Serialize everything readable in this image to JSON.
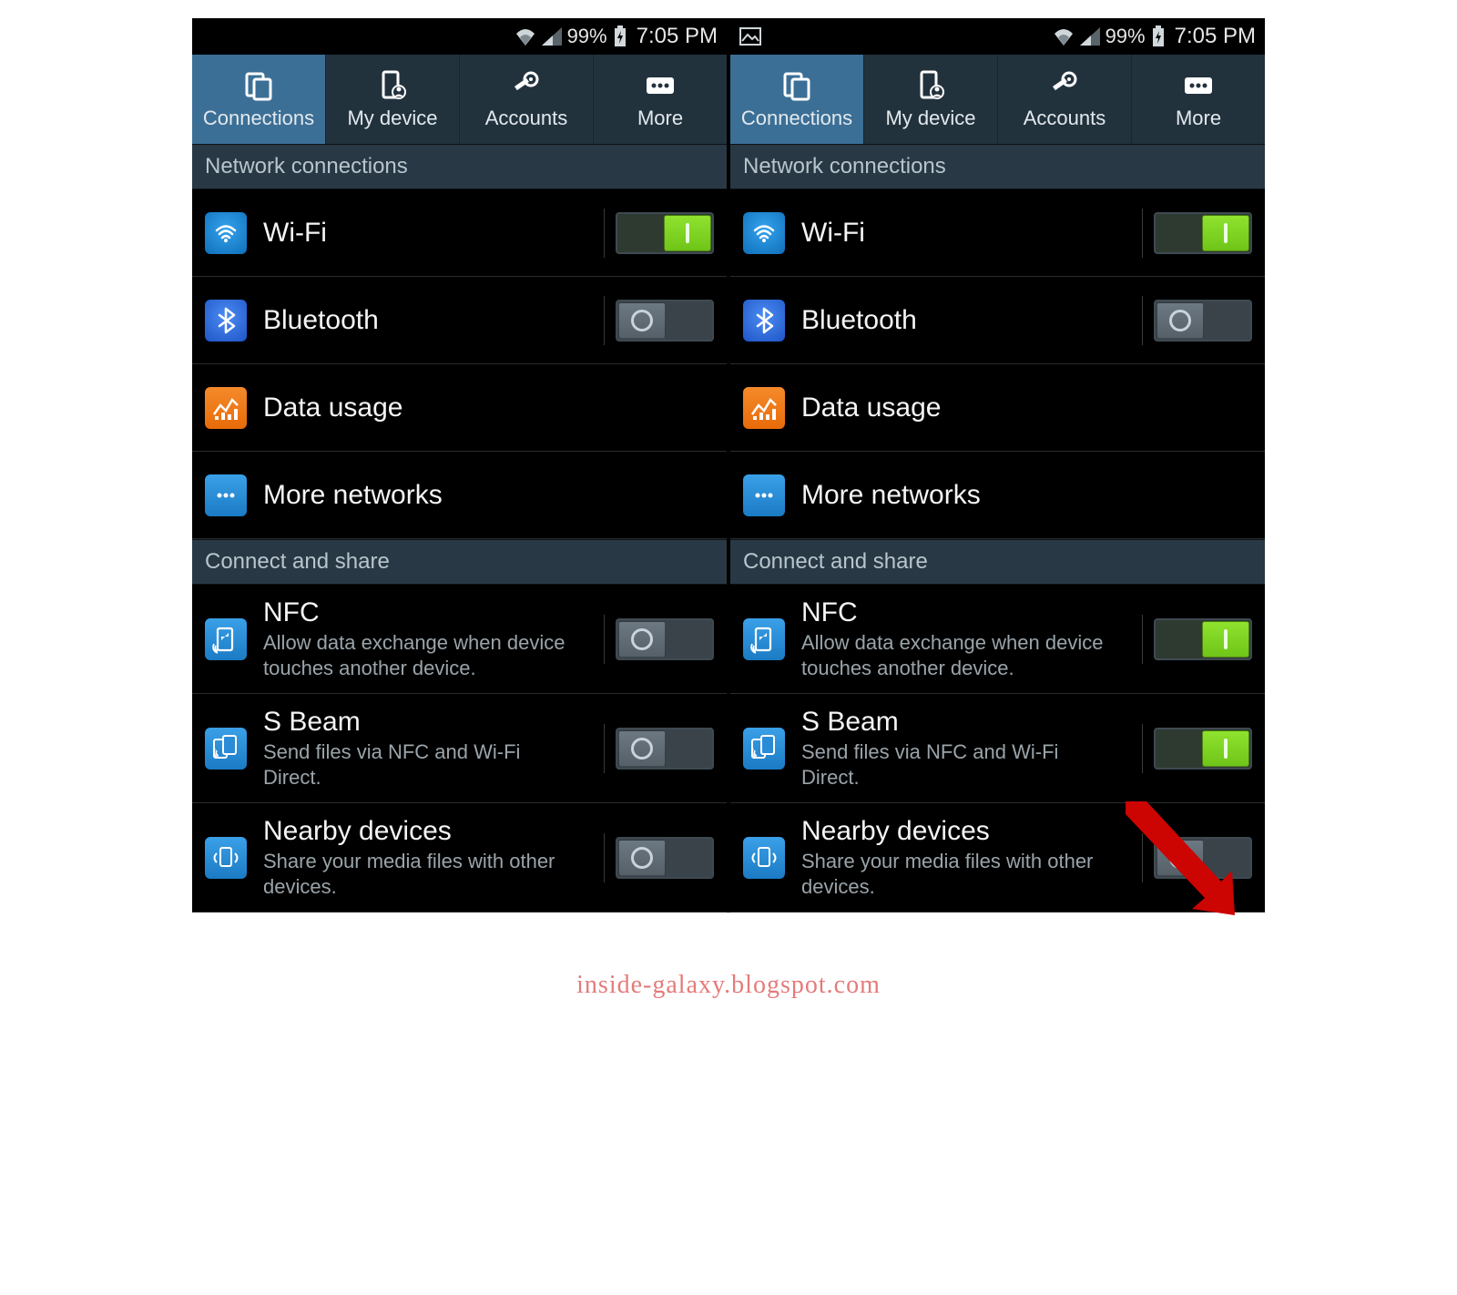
{
  "status": {
    "battery_pct": "99%",
    "time": "7:05 PM"
  },
  "tabs": [
    {
      "label": "Connections"
    },
    {
      "label": "My device"
    },
    {
      "label": "Accounts"
    },
    {
      "label": "More"
    }
  ],
  "sections": {
    "network": {
      "header": "Network connections"
    },
    "share": {
      "header": "Connect and share"
    }
  },
  "rows": {
    "wifi": {
      "title": "Wi-Fi"
    },
    "bluetooth": {
      "title": "Bluetooth"
    },
    "data": {
      "title": "Data usage"
    },
    "more_net": {
      "title": "More networks"
    },
    "nfc": {
      "title": "NFC",
      "sub": "Allow data exchange when device touches another device."
    },
    "sbeam": {
      "title": "S Beam",
      "sub": "Send files via NFC and Wi-Fi Direct."
    },
    "nearby": {
      "title": "Nearby devices",
      "sub": "Share your media files with other devices."
    }
  },
  "screens": {
    "left": {
      "toggles": {
        "wifi": true,
        "bluetooth": false,
        "nfc": false,
        "sbeam": false,
        "nearby": false
      },
      "has_picture_notification": false
    },
    "right": {
      "toggles": {
        "wifi": true,
        "bluetooth": false,
        "nfc": true,
        "sbeam": true,
        "nearby": false
      },
      "has_picture_notification": true
    }
  },
  "watermark": "inside-galaxy.blogspot.com",
  "colors": {
    "tab_active": "#3c6f96",
    "tab_bg": "#22323d",
    "section_bg": "#283844",
    "toggle_on": "#7fd221",
    "icon_wifi": "#1f8ad6",
    "icon_bt": "#2f6fe0",
    "icon_data": "#ef7a1a",
    "icon_more": "#2a8bd6",
    "icon_nfc": "#2a8bd6",
    "icon_sbeam": "#2a8bd6",
    "icon_nearby": "#2a8bd6"
  }
}
